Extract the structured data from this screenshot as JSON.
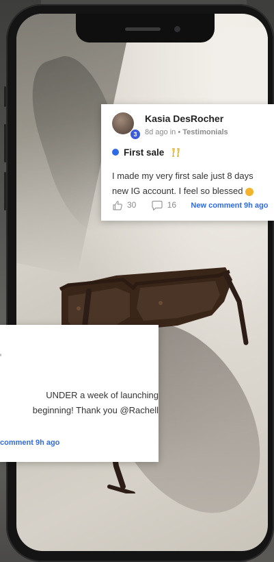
{
  "card1": {
    "author": "Kasia DesRocher",
    "level": "3",
    "time": "8d ago in",
    "sep": " • ",
    "category": "Testimonials",
    "title": "First sale",
    "body_line1": "I made my very first sale just 8 days",
    "body_line2": "new IG account. I feel so blessed",
    "likes": "30",
    "comments": "16",
    "new_comment": "New comment 9h ago"
  },
  "card2": {
    "body_line1": "UNDER a week of launching",
    "body_line2": "beginning! Thank you @Rachell",
    "new_comment": "comment 9h ago"
  },
  "colors": {
    "accent": "#2f6ae6",
    "level_badge": "#3b5bdb"
  }
}
